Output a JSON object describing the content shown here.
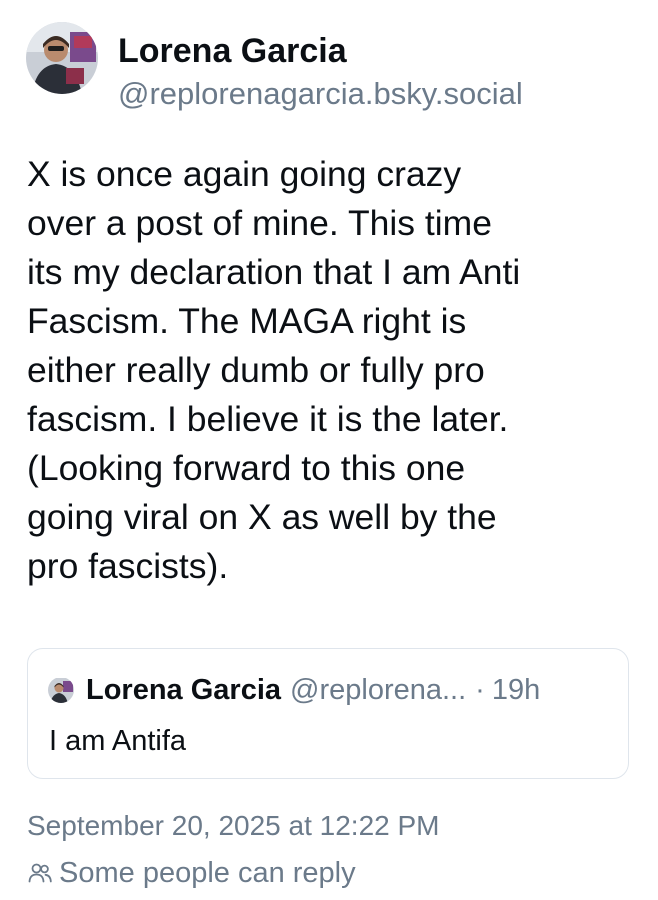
{
  "author": {
    "name": "Lorena Garcia",
    "handle": "@replorenagarcia.bsky.social",
    "avatar_icon": "profile-photo"
  },
  "post": {
    "lines": [
      "X is once again going crazy",
      "over a post of mine. This time",
      "its my declaration that I am Anti",
      "Fascism. The MAGA right is",
      "either really dumb or fully pro",
      "fascism. I believe it is the later.",
      "(Looking forward to this one",
      "going viral on X as well by the",
      "pro fascists)."
    ]
  },
  "quote": {
    "name": "Lorena Garcia",
    "handle": "@replorena...",
    "separator": "·",
    "time": "19h",
    "text": "I am Antifa",
    "avatar_icon": "profile-photo"
  },
  "meta": {
    "timestamp": "September 20, 2025 at 12:22 PM",
    "reply_setting": "Some people can reply",
    "reply_icon": "people-icon"
  },
  "colors": {
    "text": "#0b0f14",
    "muted": "#6b7a8a",
    "border": "#dfe5ec",
    "background": "#ffffff"
  }
}
